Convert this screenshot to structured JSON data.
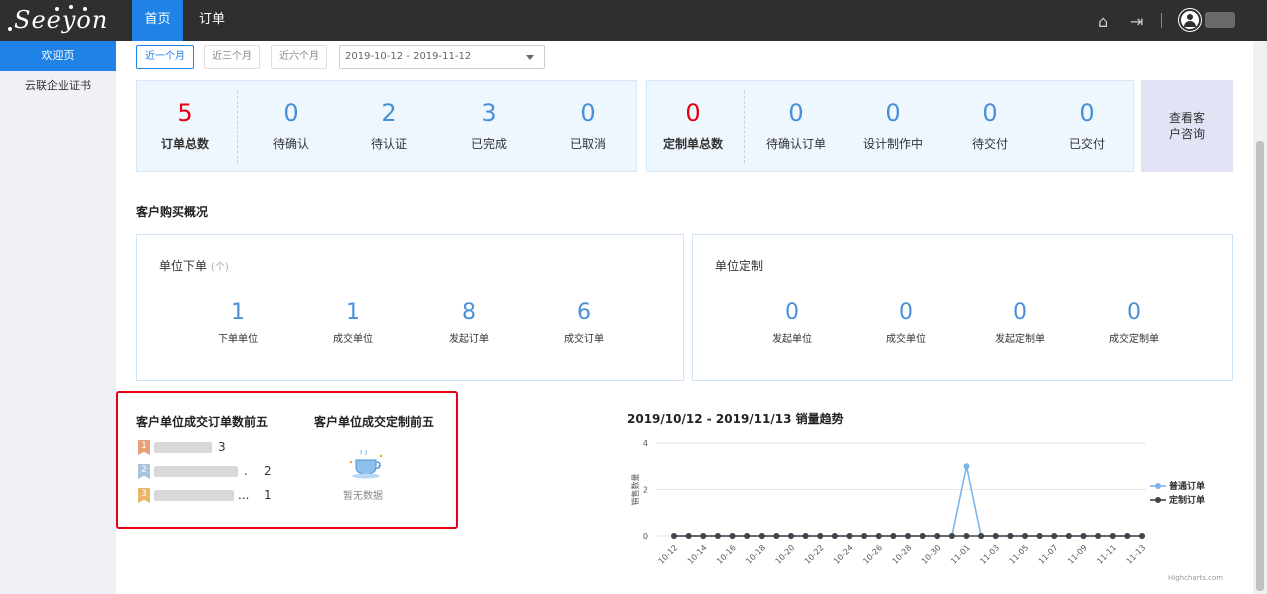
{
  "app": {
    "logo_text": "Seeyon"
  },
  "topnav": {
    "tabs": [
      {
        "label": "首页",
        "active": true
      },
      {
        "label": "订单",
        "active": false
      }
    ]
  },
  "sidebar": {
    "items": [
      {
        "label": "欢迎页",
        "active": true
      },
      {
        "label": "云联企业证书",
        "active": false
      }
    ]
  },
  "filters": {
    "buttons": [
      {
        "label": "近一个月",
        "active": true
      },
      {
        "label": "近三个月",
        "active": false
      },
      {
        "label": "近六个月",
        "active": false
      }
    ],
    "date_range": "2019-10-12 - 2019-11-12"
  },
  "order_stats": [
    {
      "value": "5",
      "label": "订单总数"
    },
    {
      "value": "0",
      "label": "待确认"
    },
    {
      "value": "2",
      "label": "待认证"
    },
    {
      "value": "3",
      "label": "已完成"
    },
    {
      "value": "0",
      "label": "已取消"
    }
  ],
  "custom_stats": [
    {
      "value": "0",
      "label": "定制单总数"
    },
    {
      "value": "0",
      "label": "待确认订单"
    },
    {
      "value": "0",
      "label": "设计制作中"
    },
    {
      "value": "0",
      "label": "待交付"
    },
    {
      "value": "0",
      "label": "已交付"
    }
  ],
  "consult": {
    "line1": "查看客",
    "line2": "户咨询"
  },
  "purchase": {
    "title": "客户购买概况",
    "unit_orders": {
      "title": "单位下单",
      "unit": "(个)",
      "stats": [
        {
          "value": "1",
          "label": "下单单位"
        },
        {
          "value": "1",
          "label": "成交单位"
        },
        {
          "value": "8",
          "label": "发起订单"
        },
        {
          "value": "6",
          "label": "成交订单"
        }
      ]
    },
    "unit_custom": {
      "title": "单位定制",
      "stats": [
        {
          "value": "0",
          "label": "发起单位"
        },
        {
          "value": "0",
          "label": "成交单位"
        },
        {
          "value": "0",
          "label": "发起定制单"
        },
        {
          "value": "0",
          "label": "成交定制单"
        }
      ]
    }
  },
  "top5": {
    "orders_title": "客户单位成交订单数前五",
    "custom_title": "客户单位成交定制前五",
    "ranks": [
      {
        "rank": "1",
        "value": "3",
        "suffix": ""
      },
      {
        "rank": "2",
        "value": "2",
        "suffix": "."
      },
      {
        "rank": "3",
        "value": "1",
        "suffix": "..."
      }
    ],
    "nodata": "暂无数据",
    "colors": {
      "rank1": "#e8a07a",
      "rank2": "#a9c3dc",
      "rank3": "#e8b76a"
    }
  },
  "chart_data": {
    "type": "line",
    "title": "2019/10/12 - 2019/11/13 销量趋势",
    "ylabel": "销售数量",
    "ylim": [
      0,
      4
    ],
    "yticks": [
      0,
      2,
      4
    ],
    "x": [
      "10-12",
      "10-13",
      "10-14",
      "10-15",
      "10-16",
      "10-17",
      "10-18",
      "10-19",
      "10-20",
      "10-21",
      "10-22",
      "10-23",
      "10-24",
      "10-25",
      "10-26",
      "10-27",
      "10-28",
      "10-29",
      "10-30",
      "10-31",
      "11-01",
      "11-02",
      "11-03",
      "11-04",
      "11-05",
      "11-06",
      "11-07",
      "11-08",
      "11-09",
      "11-10",
      "11-11",
      "11-12",
      "11-13"
    ],
    "xticklabels": [
      "10-12",
      "10-14",
      "10-16",
      "10-18",
      "10-20",
      "10-22",
      "10-24",
      "10-26",
      "10-28",
      "10-30",
      "11-01",
      "11-03",
      "11-05",
      "11-07",
      "11-09",
      "11-11",
      "11-13"
    ],
    "series": [
      {
        "name": "普通订单",
        "color": "#7cb5ec",
        "values": [
          0,
          0,
          0,
          0,
          0,
          0,
          0,
          0,
          0,
          0,
          0,
          0,
          0,
          0,
          0,
          0,
          0,
          0,
          0,
          0,
          3,
          0,
          0,
          0,
          0,
          0,
          0,
          0,
          0,
          0,
          0,
          0,
          0
        ]
      },
      {
        "name": "定制订单",
        "color": "#434348",
        "values": [
          0,
          0,
          0,
          0,
          0,
          0,
          0,
          0,
          0,
          0,
          0,
          0,
          0,
          0,
          0,
          0,
          0,
          0,
          0,
          0,
          0,
          0,
          0,
          0,
          0,
          0,
          0,
          0,
          0,
          0,
          0,
          0,
          0
        ]
      }
    ],
    "legend": "right",
    "credit": "Highcharts.com"
  }
}
